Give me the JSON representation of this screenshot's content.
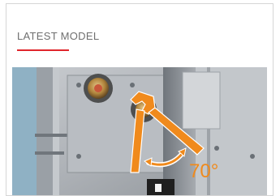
{
  "section": {
    "title": "LATEST MODEL",
    "accent_color": "#e0262c"
  },
  "illustration": {
    "angle_label": "70°",
    "highlight_color": "#f08a1c",
    "icons": [
      "valve-fitting-icon",
      "wrench-icon",
      "angle-arrow-icon"
    ]
  }
}
